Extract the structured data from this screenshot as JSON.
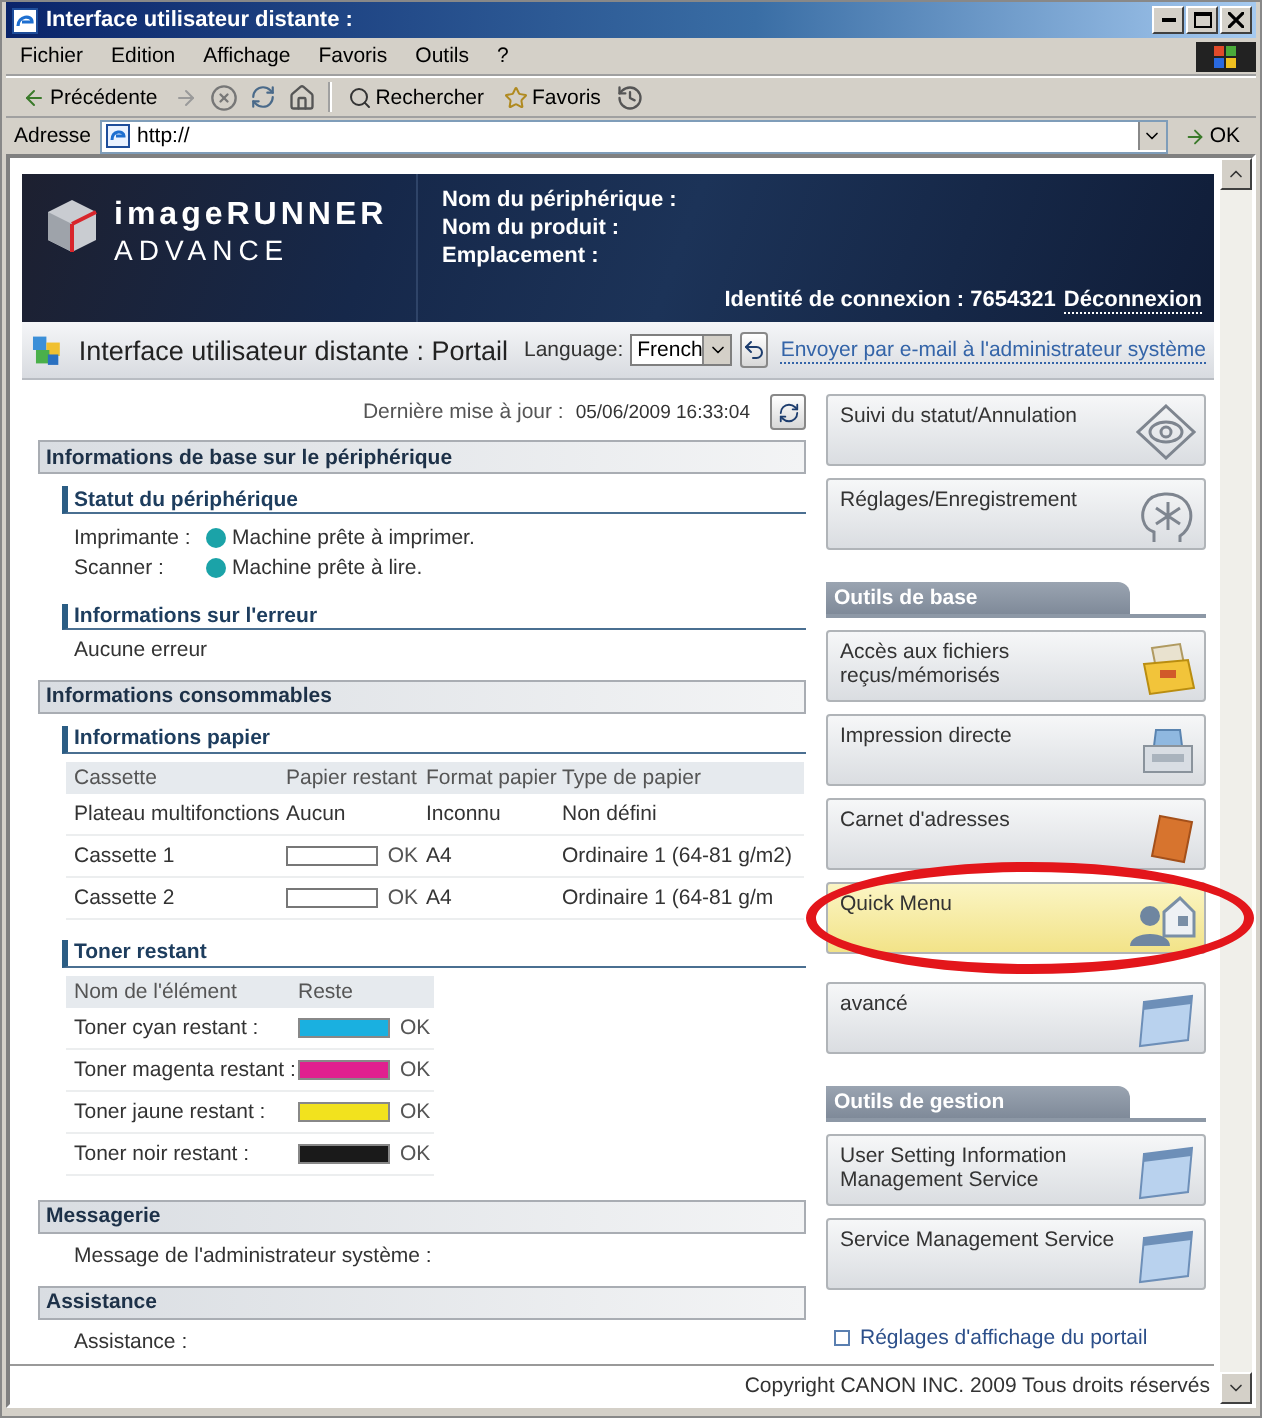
{
  "window": {
    "title": "Interface utilisateur distante :"
  },
  "menu": [
    "Fichier",
    "Edition",
    "Affichage",
    "Favoris",
    "Outils",
    "?"
  ],
  "toolbar": {
    "back": "Précédente",
    "search": "Rechercher",
    "favorites": "Favoris"
  },
  "address_bar": {
    "label": "Adresse",
    "value": "http://",
    "go": "OK"
  },
  "header": {
    "logo_line_1": "imageRUNNER",
    "logo_line_2": "ADVANCE",
    "fields": [
      "Nom du périphérique :",
      "Nom du produit :",
      "Emplacement :"
    ],
    "login": "Identité de connexion : 7654321",
    "logout": "Déconnexion"
  },
  "portal_bar": {
    "title": "Interface utilisateur distante : Portail",
    "language_label": "Language:",
    "language": "French",
    "email_link": "Envoyer par e-mail à l'administrateur système"
  },
  "last_update": {
    "label": "Dernière mise à jour :",
    "value": "05/06/2009 16:33:04"
  },
  "device_info": {
    "title": "Informations de base sur le périphérique",
    "status": {
      "title": "Statut du périphérique",
      "items": [
        {
          "label": "Imprimante :",
          "text": "Machine prête à imprimer.",
          "color": "#1ba3a8"
        },
        {
          "label": "Scanner :",
          "text": "Machine prête à lire.",
          "color": "#1ba3a8"
        }
      ]
    },
    "errors": {
      "title": "Informations sur l'erreur",
      "text": "Aucune erreur"
    }
  },
  "consumables": {
    "title": "Informations consommables",
    "paper": {
      "title": "Informations papier",
      "columns": [
        "Cassette",
        "Papier restant",
        "Format papier",
        "Type de papier"
      ],
      "rows": [
        {
          "cassette": "Plateau multifonctions",
          "kind": "text",
          "remaining": "Aucun",
          "format": "Inconnu",
          "type": "Non défini"
        },
        {
          "cassette": "Cassette 1",
          "kind": "bar",
          "remaining": "OK",
          "format": "A4",
          "type": "Ordinaire 1 (64-81 g/m2)"
        },
        {
          "cassette": "Cassette 2",
          "kind": "bar",
          "remaining": "OK",
          "format": "A4",
          "type": "Ordinaire 1 (64-81 g/m"
        }
      ]
    },
    "toner": {
      "title": "Toner restant",
      "columns": [
        "Nom de l'élément",
        "Reste"
      ],
      "rows": [
        {
          "name": "Toner cyan restant :",
          "color": "#1ab0e0",
          "level": 1,
          "status": "OK"
        },
        {
          "name": "Toner magenta restant :",
          "color": "#e0208f",
          "level": 1,
          "status": "OK"
        },
        {
          "name": "Toner jaune restant :",
          "color": "#f2e21e",
          "level": 1,
          "status": "OK"
        },
        {
          "name": "Toner noir restant :",
          "color": "#1a1a1a",
          "level": 1,
          "status": "OK"
        }
      ]
    }
  },
  "messaging": {
    "title": "Messagerie",
    "text": "Message de l'administrateur système :"
  },
  "support": {
    "title": "Assistance",
    "text": "Assistance :"
  },
  "shortcut_groups": [
    {
      "buttons": [
        {
          "label": "Suivi du statut/Annulation",
          "kind": "eye",
          "selected": false
        },
        {
          "label": "Réglages/Enregistrement",
          "kind": "asterisk",
          "selected": false
        }
      ]
    },
    {
      "title": "Outils de base",
      "buttons": [
        {
          "label": "Accès aux fichiers reçus/mémorisés",
          "kind": "drawer",
          "selected": false
        },
        {
          "label": "Impression directe",
          "kind": "printer",
          "selected": false
        },
        {
          "label": "Carnet d'adresses",
          "kind": "book",
          "selected": false
        },
        {
          "label": "Quick Menu",
          "kind": "person-house",
          "selected": true
        },
        {
          "label": "avancé",
          "kind": "window",
          "selected": false
        }
      ]
    },
    {
      "title": "Outils de gestion",
      "buttons": [
        {
          "label": "User Setting Information Management Service",
          "kind": "window",
          "selected": false
        },
        {
          "label": "Service Management Service",
          "kind": "window",
          "selected": false
        }
      ]
    }
  ],
  "portal_link": "Réglages d'affichage du portail",
  "footer": "Copyright CANON INC. 2009 Tous droits réservés"
}
